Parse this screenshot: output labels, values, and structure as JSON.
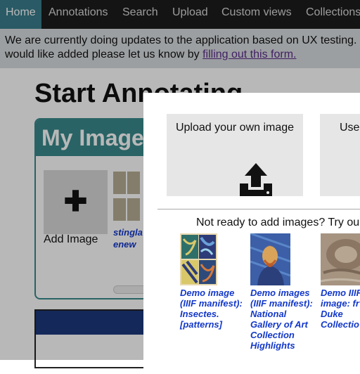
{
  "nav": {
    "items": [
      {
        "label": "Home",
        "active": true
      },
      {
        "label": "Annotations"
      },
      {
        "label": "Search"
      },
      {
        "label": "Upload"
      },
      {
        "label": "Custom views"
      },
      {
        "label": "Collections"
      }
    ]
  },
  "banner": {
    "line1": "We are currently doing updates to the application based on UX testing.",
    "line2_prefix": "would like added please let us know by",
    "link_text": "filling out this form."
  },
  "page": {
    "title": "Start Annotating",
    "my_images_title": "My Images",
    "add_image_label": "Add Image",
    "mini_label_line1": "stingla",
    "mini_label_line2": "enew"
  },
  "modal": {
    "upload_label": "Upload your own image",
    "use_label": "Use",
    "try_text": "Not ready to add images? Try ou",
    "demos": [
      {
        "caption": "Demo image (IIIF manifest): Insectes. [patterns]"
      },
      {
        "caption": "Demo images (IIIF manifest): National Gallery of Art Collection Highlights"
      },
      {
        "caption": "Demo IIIF image: fr Duke Collectio"
      }
    ]
  },
  "colors": {
    "nav_bg": "#1c1c1c",
    "active_tab": "#3a7d8c",
    "link": "#1338c9",
    "visited_link": "#5b2b8a"
  }
}
